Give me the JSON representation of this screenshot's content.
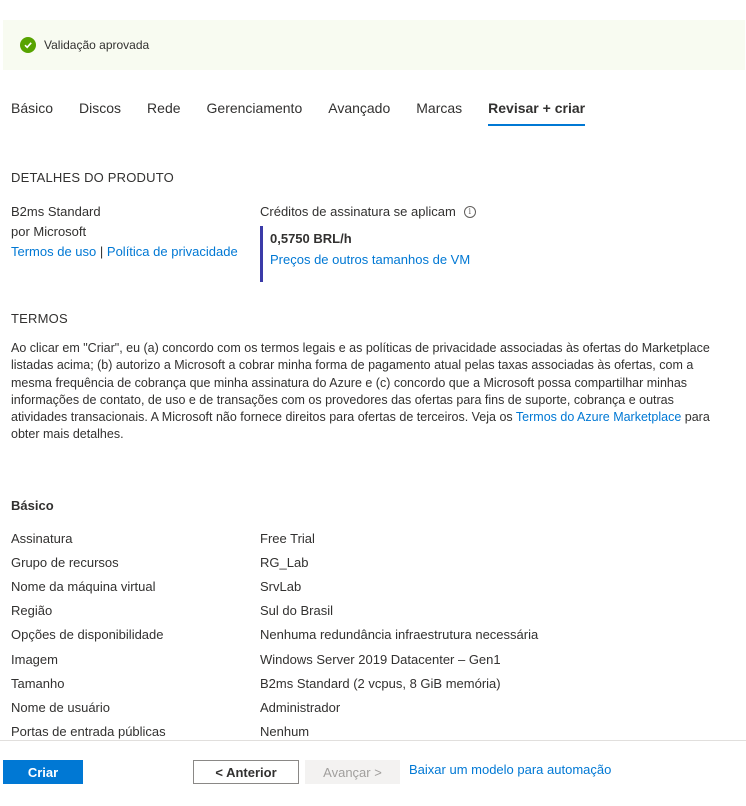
{
  "banner": {
    "text": "Validação aprovada"
  },
  "tabs": [
    {
      "label": "Básico"
    },
    {
      "label": "Discos"
    },
    {
      "label": "Rede"
    },
    {
      "label": "Gerenciamento"
    },
    {
      "label": "Avançado"
    },
    {
      "label": "Marcas"
    },
    {
      "label": "Revisar + criar"
    }
  ],
  "product": {
    "heading": "DETALHES DO PRODUTO",
    "name": "B2ms Standard",
    "publisher": "por Microsoft",
    "terms_link": "Termos de uso",
    "separator": "|",
    "privacy_link": "Política de privacidade",
    "credits_text": "Créditos de assinatura se aplicam",
    "info_glyph": "i",
    "price": "0,5750 BRL/h",
    "other_sizes_link": "Preços de outros tamanhos de VM"
  },
  "terms": {
    "heading": "TERMOS",
    "text": "Ao clicar em \"Criar\", eu (a) concordo com os termos legais e as políticas de privacidade associadas às ofertas do Marketplace listadas acima; (b) autorizo a Microsoft a cobrar minha forma de pagamento atual pelas taxas associadas às ofertas, com a mesma frequência de cobrança que minha assinatura do Azure e (c) concordo que a Microsoft possa compartilhar minhas informações de contato, de uso e de transações com os provedores das ofertas para fins de suporte, cobrança e outras atividades transacionais. A Microsoft não fornece direitos para ofertas de terceiros. Veja os ",
    "link": "Termos do Azure Marketplace",
    "text_after": " para obter mais detalhes."
  },
  "summary": {
    "title": "Básico",
    "rows": [
      {
        "label": "Assinatura",
        "value": "Free Trial"
      },
      {
        "label": "Grupo de recursos",
        "value": "RG_Lab"
      },
      {
        "label": "Nome da máquina virtual",
        "value": "SrvLab"
      },
      {
        "label": "Região",
        "value": "Sul do Brasil"
      },
      {
        "label": "Opções de disponibilidade",
        "value": "Nenhuma redundância infraestrutura necessária"
      },
      {
        "label": "Imagem",
        "value": "Windows Server 2019 Datacenter – Gen1"
      },
      {
        "label": "Tamanho",
        "value": "B2ms Standard (2 vcpus, 8 GiB memória)"
      },
      {
        "label": "Nome de usuário",
        "value": "Administrador"
      },
      {
        "label": "Portas de entrada públicas",
        "value": "Nenhum"
      }
    ]
  },
  "footer": {
    "create_label": "Criar",
    "prev_label": "< Anterior",
    "next_label": "Avançar >",
    "template_link": "Baixar um modelo para automação"
  },
  "colors": {
    "accent": "#0078d4",
    "success": "#57a300",
    "banner_bg": "#f8fbf1",
    "price_bar": "#3b3ba8"
  }
}
